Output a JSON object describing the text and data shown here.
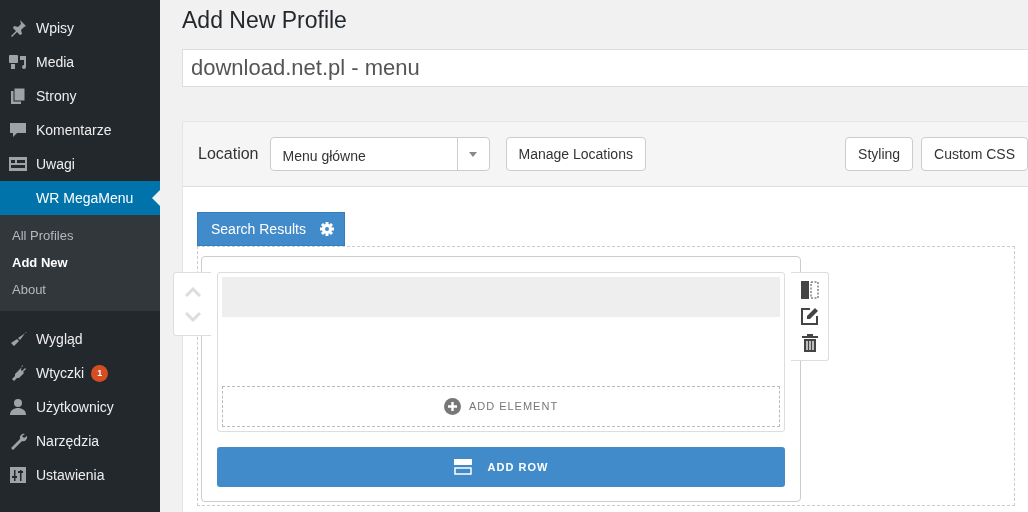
{
  "sidebar": {
    "items": [
      {
        "label": "Wpisy",
        "selected": false
      },
      {
        "label": "Media",
        "selected": false
      },
      {
        "label": "Strony",
        "selected": false
      },
      {
        "label": "Komentarze",
        "selected": false
      },
      {
        "label": "Uwagi",
        "selected": false
      },
      {
        "label": "WR MegaMenu",
        "selected": true,
        "children": [
          {
            "label": "All Profiles",
            "selected": false
          },
          {
            "label": "Add New",
            "selected": true
          },
          {
            "label": "About",
            "selected": false
          }
        ]
      },
      {
        "label": "Wygląd",
        "selected": false
      },
      {
        "label": "Wtyczki",
        "selected": false,
        "badge": "1"
      },
      {
        "label": "Użytkownicy",
        "selected": false
      },
      {
        "label": "Narzędzia",
        "selected": false
      },
      {
        "label": "Ustawienia",
        "selected": false
      }
    ]
  },
  "page": {
    "title": "Add New Profile",
    "profile_name": "download.net.pl - menu"
  },
  "toolbar": {
    "location_label": "Location",
    "location_value": "Menu główne",
    "manage_button": "Manage Locations",
    "right_buttons": [
      "Styling",
      "Custom CSS"
    ]
  },
  "builder": {
    "tab": "Search Results",
    "add_element": "ADD ELEMENT",
    "add_row": "ADD ROW"
  }
}
